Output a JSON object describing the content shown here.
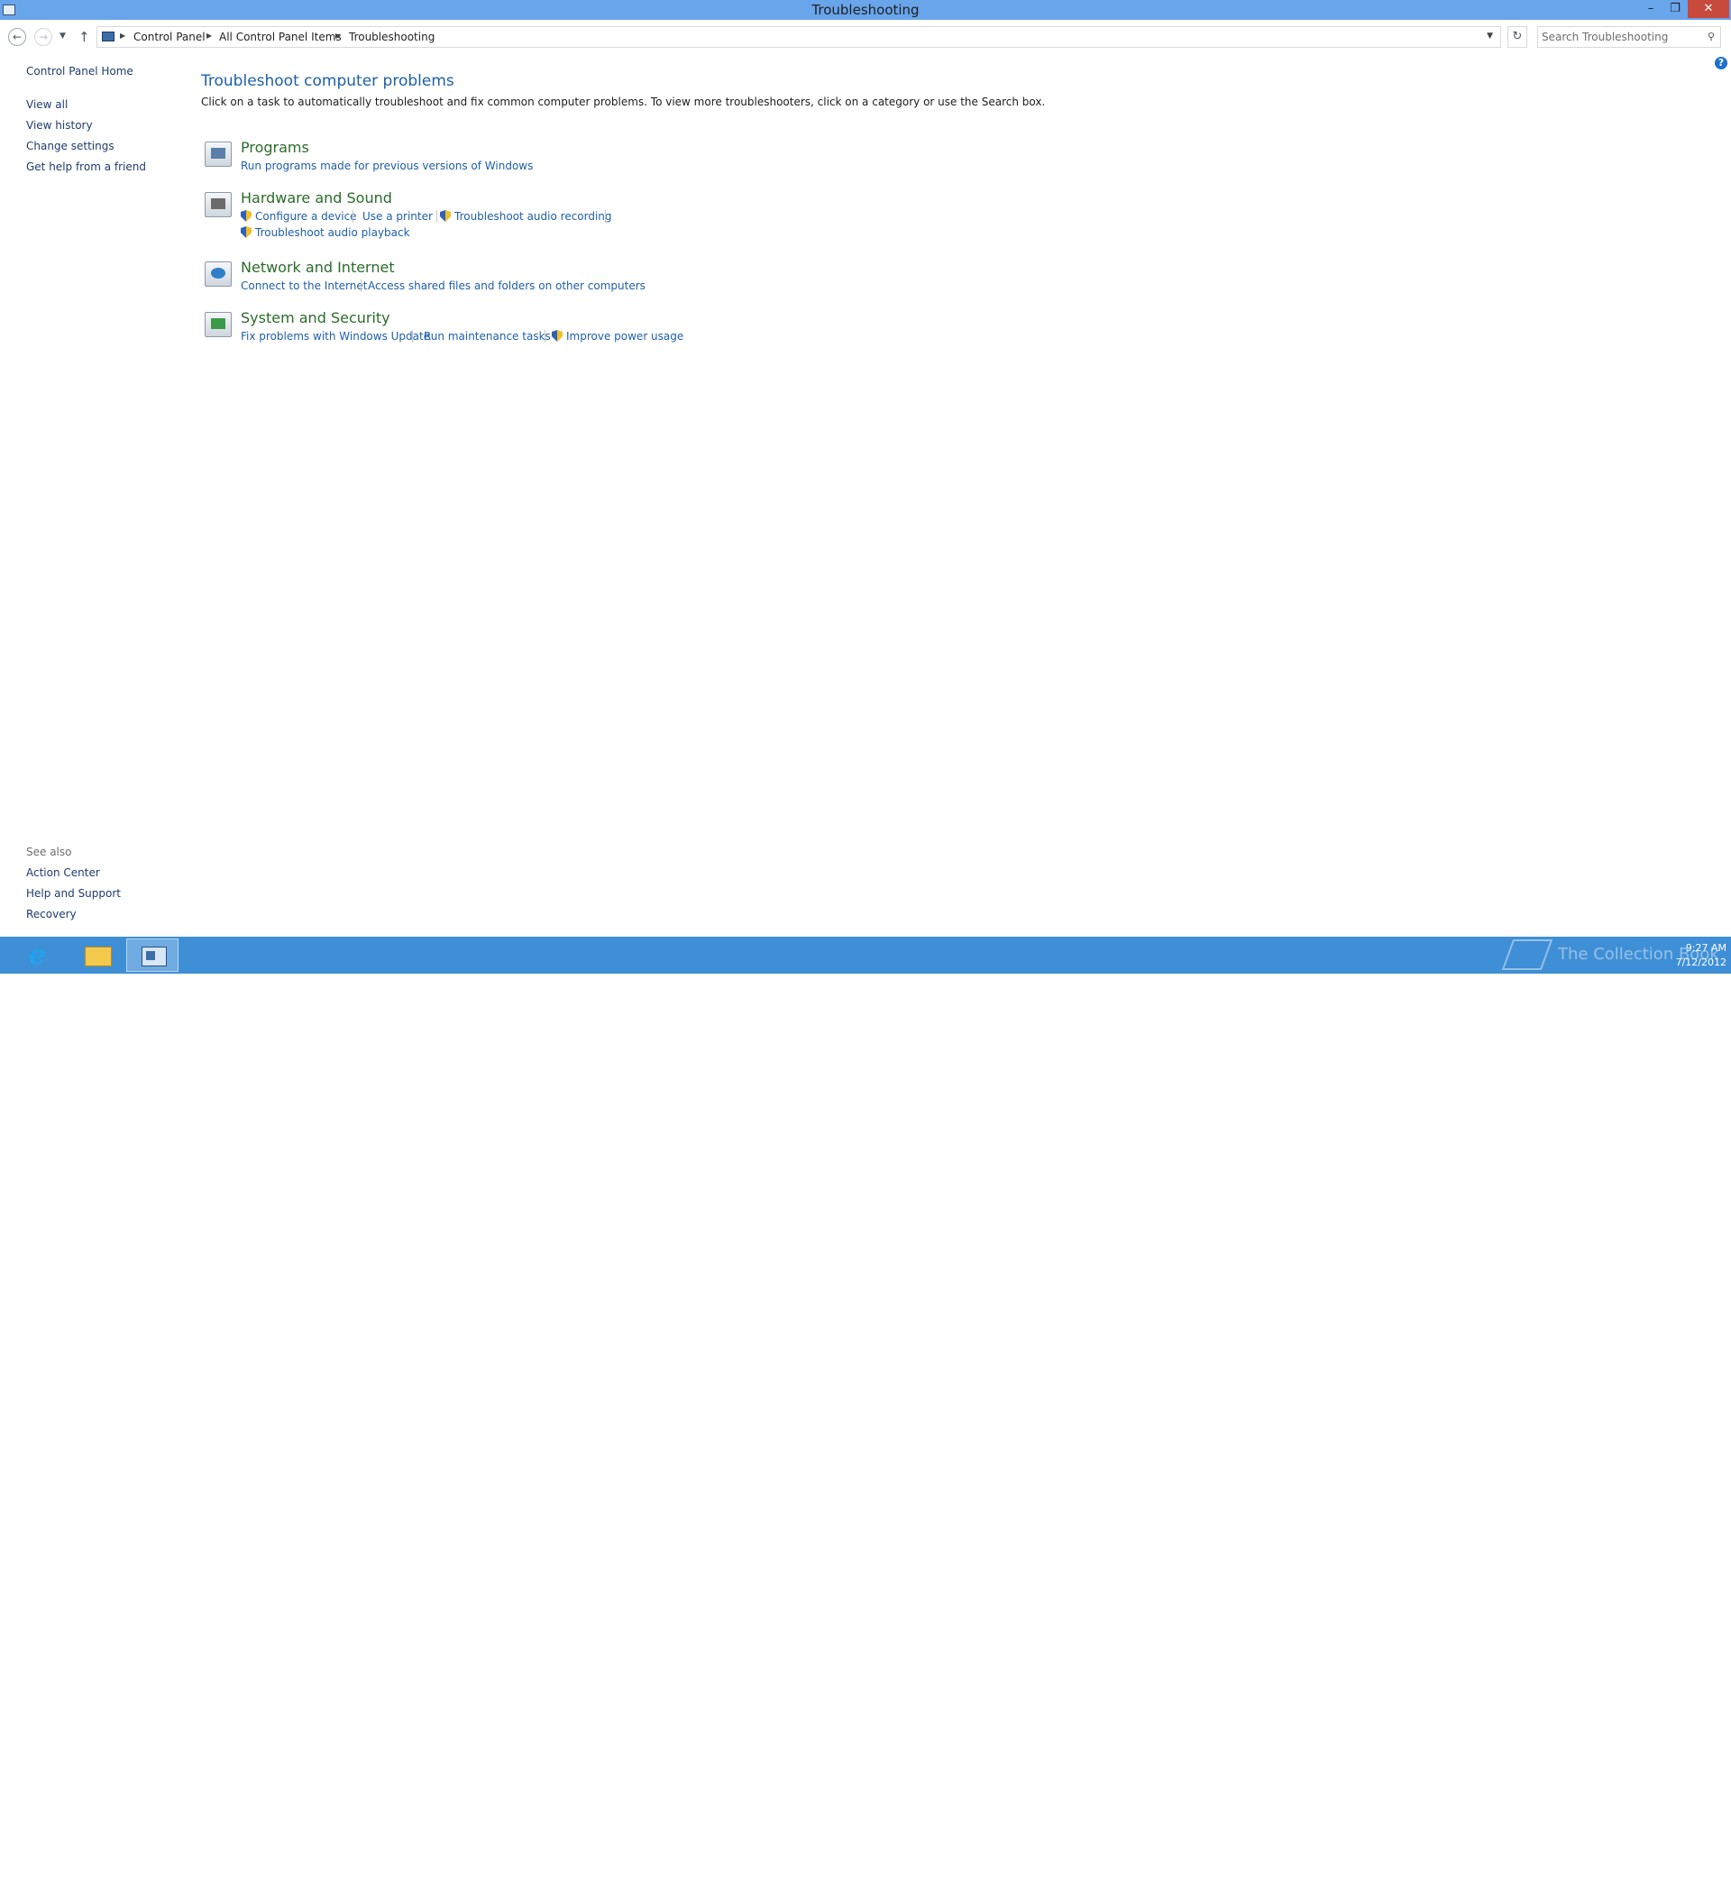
{
  "window": {
    "title": "Troubleshooting"
  },
  "window_controls": {
    "minimize": "–",
    "maximize": "❐",
    "close": "✕"
  },
  "breadcrumb": [
    "Control Panel",
    "All Control Panel Items",
    "Troubleshooting"
  ],
  "search": {
    "placeholder": "Search Troubleshooting"
  },
  "sidebar": {
    "home": "Control Panel Home",
    "items": [
      "View all",
      "View history",
      "Change settings",
      "Get help from a friend"
    ]
  },
  "main": {
    "title": "Troubleshoot computer problems",
    "description": "Click on a task to automatically troubleshoot and fix common computer problems. To view more troubleshooters, click on a category or use the Search box.",
    "categories": [
      {
        "title": "Programs",
        "icon": "programs-icon",
        "tasks": [
          {
            "label": "Run programs made for previous versions of Windows",
            "shield": false
          }
        ]
      },
      {
        "title": "Hardware and Sound",
        "icon": "hardware-sound-icon",
        "tasks": [
          {
            "label": "Configure a device",
            "shield": true
          },
          {
            "label": "Use a printer",
            "shield": false
          },
          {
            "label": "Troubleshoot audio recording",
            "shield": true
          },
          {
            "label": "Troubleshoot audio playback",
            "shield": true
          }
        ]
      },
      {
        "title": "Network and Internet",
        "icon": "network-internet-icon",
        "tasks": [
          {
            "label": "Connect to the Internet",
            "shield": false
          },
          {
            "label": "Access shared files and folders on other computers",
            "shield": false
          }
        ]
      },
      {
        "title": "System and Security",
        "icon": "system-security-icon",
        "tasks": [
          {
            "label": "Fix problems with Windows Update",
            "shield": false
          },
          {
            "label": "Run maintenance tasks",
            "shield": false
          },
          {
            "label": "Improve power usage",
            "shield": true
          }
        ]
      }
    ]
  },
  "see_also": {
    "heading": "See also",
    "items": [
      "Action Center",
      "Help and Support",
      "Recovery"
    ]
  },
  "taskbar": {
    "apps": [
      "internet-explorer-icon",
      "file-explorer-icon",
      "control-panel-icon"
    ],
    "watermark": "The Collection Book",
    "clock": {
      "time": "9:27 AM",
      "date": "7/12/2012"
    }
  },
  "colors": {
    "titlebar": "#68a5eb",
    "taskbar": "#3f8fd6",
    "link": "#1e5fa8",
    "category": "#2b6b2b"
  }
}
